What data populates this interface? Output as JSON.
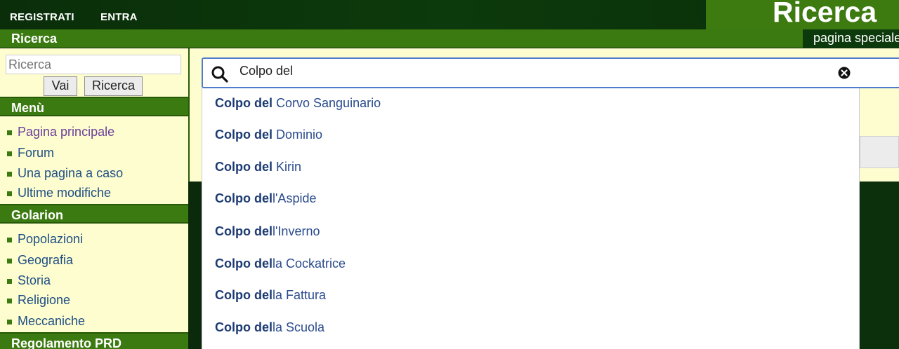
{
  "header": {
    "register_label": "REGISTRATI",
    "login_label": "ENTRA",
    "page_title": "Ricerca",
    "section_title": "Ricerca",
    "special_label": "pagina speciale"
  },
  "sidebar": {
    "search_placeholder": "Ricerca",
    "go_label": "Vai",
    "search_button_label": "Ricerca",
    "menu_title": "Menù",
    "menu_items": [
      "Pagina principale",
      "Forum",
      "Una pagina a caso",
      "Ultime modifiche"
    ],
    "golarion_title": "Golarion",
    "golarion_items": [
      "Popolazioni",
      "Geografia",
      "Storia",
      "Religione",
      "Meccaniche"
    ],
    "rules_title": "Regolamento PRD"
  },
  "search": {
    "query": "Colpo del",
    "icon": "search-icon",
    "clear_icon": "clear-icon"
  },
  "suggestions": [
    {
      "match": "Colpo del",
      "rest": " Corvo Sanguinario"
    },
    {
      "match": "Colpo del",
      "rest": " Dominio"
    },
    {
      "match": "Colpo del",
      "rest": " Kirin"
    },
    {
      "match": "Colpo del",
      "rest": "l'Aspide"
    },
    {
      "match": "Colpo del",
      "rest": "l'Inverno"
    },
    {
      "match": "Colpo del",
      "rest": "la Cockatrice"
    },
    {
      "match": "Colpo del",
      "rest": "la Fattura"
    },
    {
      "match": "Colpo del",
      "rest": "la Scuola"
    }
  ],
  "colors": {
    "header_green": "#3b7a10",
    "dark_green": "#0c3a0c",
    "sidebar_bg": "#fdfdd0",
    "link_blue": "#1f4f84",
    "visited_purple": "#6b3f9a",
    "focus_blue": "#4f7ccd"
  }
}
